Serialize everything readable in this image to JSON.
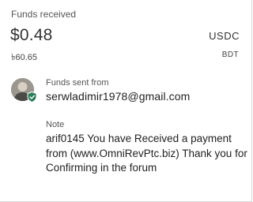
{
  "funds": {
    "label": "Funds received",
    "amount": "$0.48",
    "currency": "USDC",
    "local_amount": "৳60.65",
    "local_currency": "BDT"
  },
  "sender": {
    "label": "Funds sent from",
    "email": "serwladimir1978@gmail.com",
    "verified_icon": "shield-check-icon"
  },
  "note": {
    "label": "Note",
    "text": "arif0145 You have Received a payment from (www.OmniRevPtc.biz) Thank you for Confirming in the forum"
  },
  "colors": {
    "shield": "#2e7d5b"
  }
}
